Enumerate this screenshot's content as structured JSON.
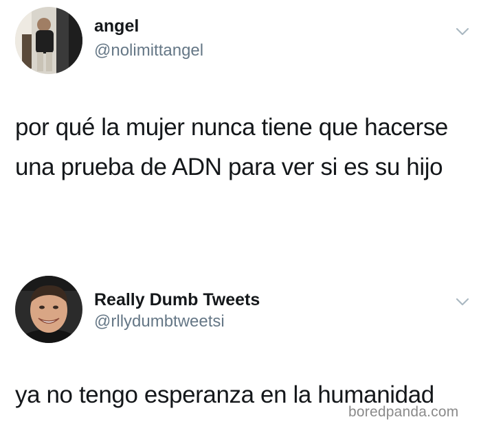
{
  "tweets": [
    {
      "display_name": "angel",
      "handle": "@nolimittangel",
      "text": "por qué la mujer nunca tiene que hacerse una prueba de ADN para ver si es su hijo",
      "avatar_icon": "user-photo-mirror-selfie",
      "menu_icon": "chevron-down-icon"
    },
    {
      "display_name": "Really Dumb Tweets",
      "handle": "@rllydumbtweetsi",
      "text": "ya no tengo esperanza en la humanidad",
      "avatar_icon": "user-photo-smiling-man",
      "menu_icon": "chevron-down-icon"
    }
  ],
  "watermark": "boredpanda.com",
  "colors": {
    "text": "#14171a",
    "secondary_text": "#657786",
    "chevron": "#aab8c2",
    "watermark": "#8a8a8a",
    "background": "#ffffff"
  }
}
